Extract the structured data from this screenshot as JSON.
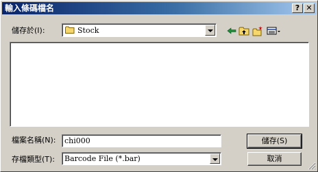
{
  "window": {
    "title": "輸入條碼檔名"
  },
  "titlebar": {
    "help_button": "?",
    "close_button": "✕"
  },
  "save_in": {
    "label": "儲存於(I):",
    "value": "Stock"
  },
  "file_name": {
    "label": "檔案名稱(N):",
    "value": "chi000"
  },
  "file_type": {
    "label": "存檔類型(T):",
    "value": "Barcode File (*.bar)"
  },
  "buttons": {
    "save": "儲存(S)",
    "cancel": "取消"
  },
  "icons": {
    "back": "back-arrow-icon",
    "up": "up-folder-icon",
    "new_folder": "new-folder-icon",
    "view_menu": "view-menu-icon"
  }
}
